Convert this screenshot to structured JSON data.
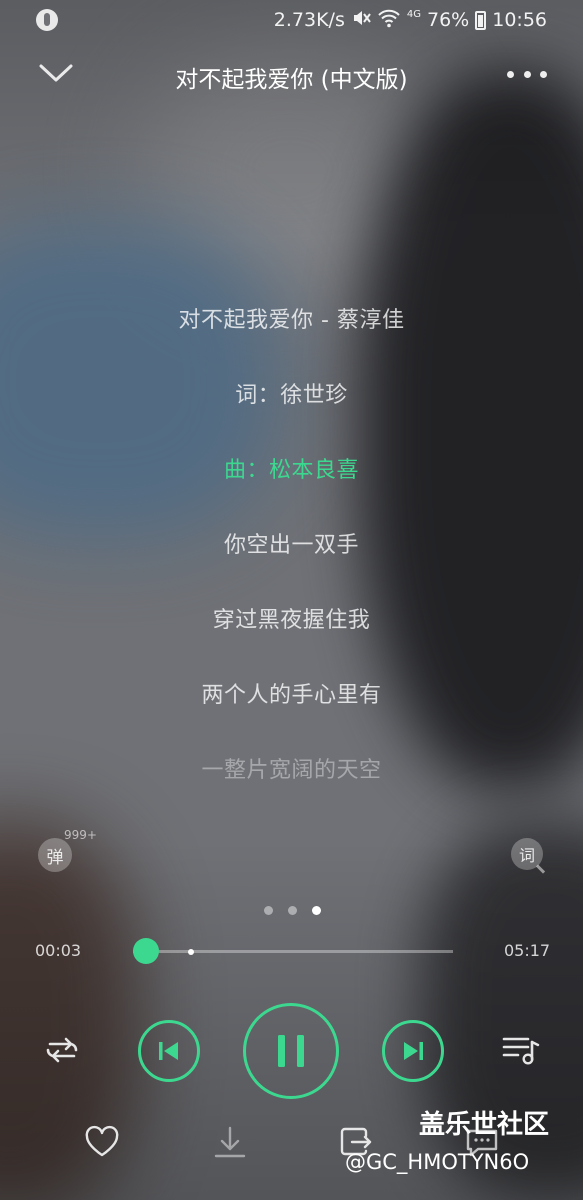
{
  "status_bar": {
    "speed": "2.73K/s",
    "network": "4G",
    "battery": "76%",
    "time": "10:56",
    "icons": [
      "app-icon",
      "mute-icon",
      "wifi-icon",
      "battery-icon"
    ]
  },
  "header": {
    "title": "对不起我爱你 (中文版)"
  },
  "lyrics": [
    {
      "text": "对不起我爱你 - 蔡淳佳",
      "state": "normal"
    },
    {
      "text": "词：徐世珍",
      "state": "normal"
    },
    {
      "text": "曲：松本良喜",
      "state": "active"
    },
    {
      "text": "你空出一双手",
      "state": "normal"
    },
    {
      "text": "穿过黑夜握住我",
      "state": "normal"
    },
    {
      "text": "两个人的手心里有",
      "state": "normal"
    },
    {
      "text": "一整片宽阔的天空",
      "state": "faded"
    }
  ],
  "side": {
    "danmu_label": "弹",
    "danmu_count": "999+",
    "lyric_label": "词"
  },
  "pager": {
    "count": 3,
    "active": 3
  },
  "progress": {
    "current": "00:03",
    "duration": "05:17",
    "played_fraction": 0.01,
    "buffered_fraction": 0.18
  },
  "controls": {
    "icons": [
      "repeat-icon",
      "previous-icon",
      "pause-icon",
      "next-icon",
      "playlist-icon"
    ]
  },
  "bottom_actions": {
    "icons": [
      "heart-icon",
      "download-icon",
      "share-icon",
      "comment-icon"
    ]
  },
  "watermark": {
    "title": "盖乐世社区",
    "handle": "@GC_HMOTYN6O"
  },
  "colors": {
    "accent": "#3dd88f",
    "text": "#ffffff"
  }
}
